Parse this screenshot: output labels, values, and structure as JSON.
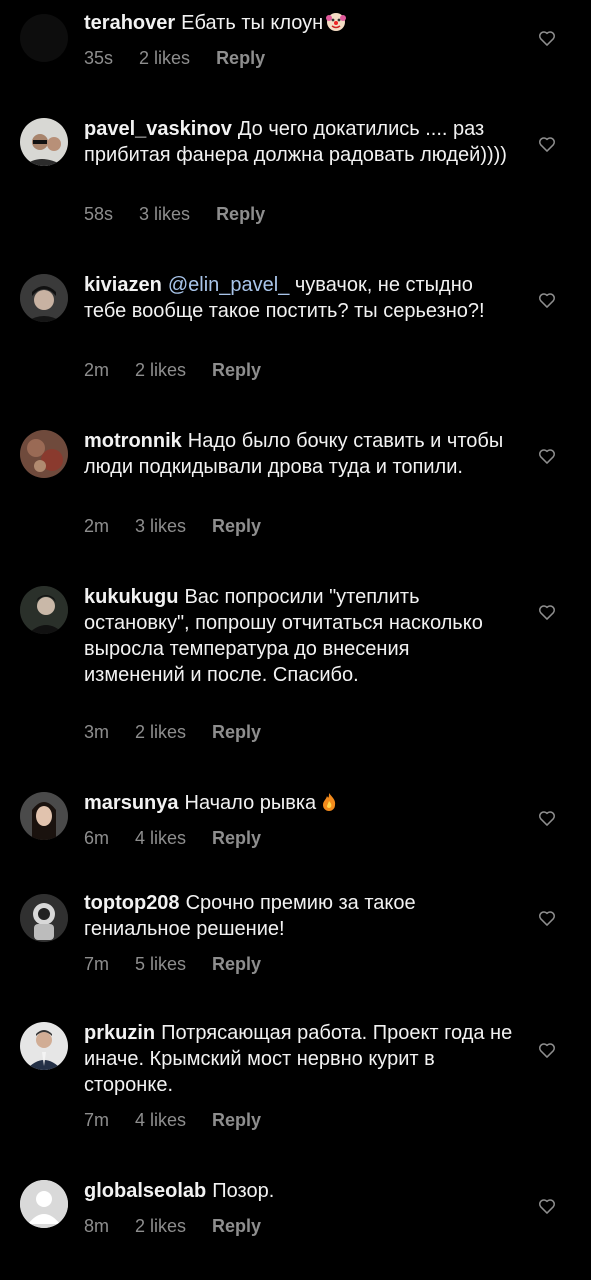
{
  "comments": [
    {
      "username": "terahover",
      "text": "Ебать ты клоун",
      "mention": "",
      "emoji": "clown-emoji",
      "time": "35s",
      "likes": "2 likes",
      "reply": "Reply"
    },
    {
      "username": "pavel_vaskinov",
      "text": "До чего докатились .... раз прибитая фанера должна радовать людей))))",
      "mention": "",
      "emoji": "",
      "time": "58s",
      "likes": "3 likes",
      "reply": "Reply"
    },
    {
      "username": "kiviazen",
      "mention": "@elin_pavel_",
      "text": "чувачок, не стыдно тебе вообще такое постить? ты серьезно?!",
      "emoji": "",
      "time": "2m",
      "likes": "2 likes",
      "reply": "Reply"
    },
    {
      "username": "motronnik",
      "text": "Надо было бочку ставить и чтобы люди подкидывали дрова туда и топили.",
      "mention": "",
      "emoji": "",
      "time": "2m",
      "likes": "3 likes",
      "reply": "Reply"
    },
    {
      "username": "kukukugu",
      "text": "Вас попросили \"утеплить остановку\", попрошу отчитаться насколько выросла температура до внесения изменений и после. Спасибо.",
      "mention": "",
      "emoji": "",
      "time": "3m",
      "likes": "2 likes",
      "reply": "Reply"
    },
    {
      "username": "marsunya",
      "text": "Начало рывка",
      "mention": "",
      "emoji": "fire-emoji",
      "time": "6m",
      "likes": "4 likes",
      "reply": "Reply"
    },
    {
      "username": "toptop208",
      "text": "Срочно премию за такое гениальное решение!",
      "mention": "",
      "emoji": "",
      "time": "7m",
      "likes": "5 likes",
      "reply": "Reply"
    },
    {
      "username": "prkuzin",
      "text": "Потрясающая работа. Проект года не иначе. Крымский мост нервно курит в сторонке.",
      "mention": "",
      "emoji": "",
      "time": "7m",
      "likes": "4 likes",
      "reply": "Reply"
    },
    {
      "username": "globalseolab",
      "text": "Позор.",
      "mention": "",
      "emoji": "",
      "time": "8m",
      "likes": "2 likes",
      "reply": "Reply"
    }
  ],
  "icons": {
    "like": "heart-outline-icon"
  },
  "colors": {
    "background": "#000000",
    "text": "#f2f2f2",
    "meta": "#8e8e8e",
    "mention": "#a9c5ea"
  }
}
